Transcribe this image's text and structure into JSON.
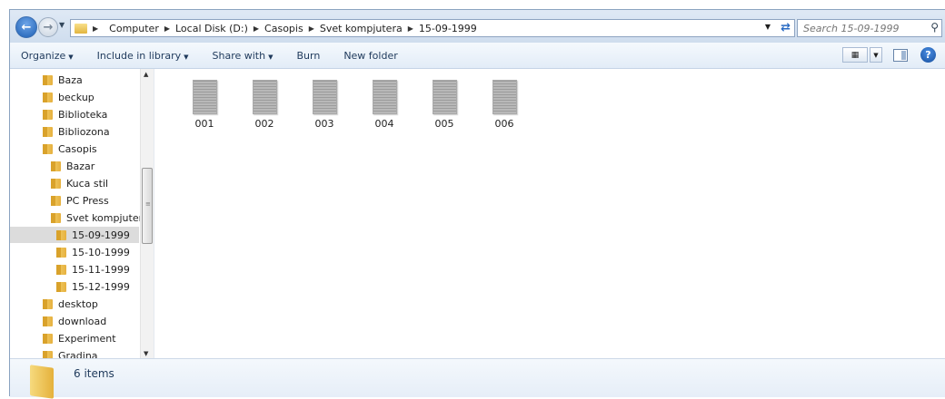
{
  "window": {
    "breadcrumbs": [
      "Computer",
      "Local Disk (D:)",
      "Casopis",
      "Svet kompjutera",
      "15-09-1999"
    ],
    "search_placeholder": "Search 15-09-1999"
  },
  "toolbar": {
    "organize": "Organize",
    "include_library": "Include in library",
    "share_with": "Share with",
    "burn": "Burn",
    "new_folder": "New folder"
  },
  "nav_tree": [
    {
      "label": "Baza",
      "indent": 0
    },
    {
      "label": "beckup",
      "indent": 0
    },
    {
      "label": "Biblioteka",
      "indent": 0
    },
    {
      "label": "Bibliozona",
      "indent": 0
    },
    {
      "label": "Casopis",
      "indent": 0
    },
    {
      "label": "Bazar",
      "indent": 1
    },
    {
      "label": "Kuca stil",
      "indent": 1
    },
    {
      "label": "PC Press",
      "indent": 1
    },
    {
      "label": "Svet kompjutera",
      "indent": 1
    },
    {
      "label": "15-09-1999",
      "indent": 2,
      "selected": true
    },
    {
      "label": "15-10-1999",
      "indent": 2
    },
    {
      "label": "15-11-1999",
      "indent": 2
    },
    {
      "label": "15-12-1999",
      "indent": 2
    },
    {
      "label": "desktop",
      "indent": 0
    },
    {
      "label": "download",
      "indent": 0
    },
    {
      "label": "Experiment",
      "indent": 0
    },
    {
      "label": "Gradina",
      "indent": 0
    }
  ],
  "files": [
    "001",
    "002",
    "003",
    "004",
    "005",
    "006"
  ],
  "status": {
    "item_count": "6 items"
  },
  "colors": {
    "chrome": "#dfe9f5",
    "accent": "#1e395b",
    "folder": "#e6b13f",
    "selection": "#dcdcdc"
  }
}
